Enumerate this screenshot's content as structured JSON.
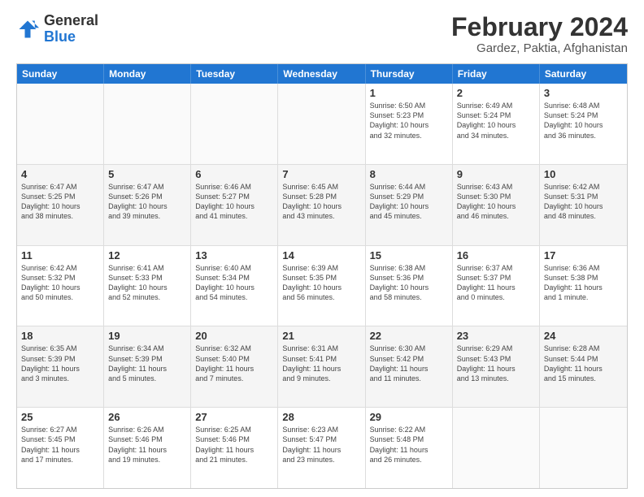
{
  "header": {
    "logo": {
      "general": "General",
      "blue": "Blue"
    },
    "title": "February 2024",
    "subtitle": "Gardez, Paktia, Afghanistan"
  },
  "calendar": {
    "days_of_week": [
      "Sunday",
      "Monday",
      "Tuesday",
      "Wednesday",
      "Thursday",
      "Friday",
      "Saturday"
    ],
    "weeks": [
      [
        {
          "day": "",
          "info": ""
        },
        {
          "day": "",
          "info": ""
        },
        {
          "day": "",
          "info": ""
        },
        {
          "day": "",
          "info": ""
        },
        {
          "day": "1",
          "info": "Sunrise: 6:50 AM\nSunset: 5:23 PM\nDaylight: 10 hours\nand 32 minutes."
        },
        {
          "day": "2",
          "info": "Sunrise: 6:49 AM\nSunset: 5:24 PM\nDaylight: 10 hours\nand 34 minutes."
        },
        {
          "day": "3",
          "info": "Sunrise: 6:48 AM\nSunset: 5:24 PM\nDaylight: 10 hours\nand 36 minutes."
        }
      ],
      [
        {
          "day": "4",
          "info": "Sunrise: 6:47 AM\nSunset: 5:25 PM\nDaylight: 10 hours\nand 38 minutes."
        },
        {
          "day": "5",
          "info": "Sunrise: 6:47 AM\nSunset: 5:26 PM\nDaylight: 10 hours\nand 39 minutes."
        },
        {
          "day": "6",
          "info": "Sunrise: 6:46 AM\nSunset: 5:27 PM\nDaylight: 10 hours\nand 41 minutes."
        },
        {
          "day": "7",
          "info": "Sunrise: 6:45 AM\nSunset: 5:28 PM\nDaylight: 10 hours\nand 43 minutes."
        },
        {
          "day": "8",
          "info": "Sunrise: 6:44 AM\nSunset: 5:29 PM\nDaylight: 10 hours\nand 45 minutes."
        },
        {
          "day": "9",
          "info": "Sunrise: 6:43 AM\nSunset: 5:30 PM\nDaylight: 10 hours\nand 46 minutes."
        },
        {
          "day": "10",
          "info": "Sunrise: 6:42 AM\nSunset: 5:31 PM\nDaylight: 10 hours\nand 48 minutes."
        }
      ],
      [
        {
          "day": "11",
          "info": "Sunrise: 6:42 AM\nSunset: 5:32 PM\nDaylight: 10 hours\nand 50 minutes."
        },
        {
          "day": "12",
          "info": "Sunrise: 6:41 AM\nSunset: 5:33 PM\nDaylight: 10 hours\nand 52 minutes."
        },
        {
          "day": "13",
          "info": "Sunrise: 6:40 AM\nSunset: 5:34 PM\nDaylight: 10 hours\nand 54 minutes."
        },
        {
          "day": "14",
          "info": "Sunrise: 6:39 AM\nSunset: 5:35 PM\nDaylight: 10 hours\nand 56 minutes."
        },
        {
          "day": "15",
          "info": "Sunrise: 6:38 AM\nSunset: 5:36 PM\nDaylight: 10 hours\nand 58 minutes."
        },
        {
          "day": "16",
          "info": "Sunrise: 6:37 AM\nSunset: 5:37 PM\nDaylight: 11 hours\nand 0 minutes."
        },
        {
          "day": "17",
          "info": "Sunrise: 6:36 AM\nSunset: 5:38 PM\nDaylight: 11 hours\nand 1 minute."
        }
      ],
      [
        {
          "day": "18",
          "info": "Sunrise: 6:35 AM\nSunset: 5:39 PM\nDaylight: 11 hours\nand 3 minutes."
        },
        {
          "day": "19",
          "info": "Sunrise: 6:34 AM\nSunset: 5:39 PM\nDaylight: 11 hours\nand 5 minutes."
        },
        {
          "day": "20",
          "info": "Sunrise: 6:32 AM\nSunset: 5:40 PM\nDaylight: 11 hours\nand 7 minutes."
        },
        {
          "day": "21",
          "info": "Sunrise: 6:31 AM\nSunset: 5:41 PM\nDaylight: 11 hours\nand 9 minutes."
        },
        {
          "day": "22",
          "info": "Sunrise: 6:30 AM\nSunset: 5:42 PM\nDaylight: 11 hours\nand 11 minutes."
        },
        {
          "day": "23",
          "info": "Sunrise: 6:29 AM\nSunset: 5:43 PM\nDaylight: 11 hours\nand 13 minutes."
        },
        {
          "day": "24",
          "info": "Sunrise: 6:28 AM\nSunset: 5:44 PM\nDaylight: 11 hours\nand 15 minutes."
        }
      ],
      [
        {
          "day": "25",
          "info": "Sunrise: 6:27 AM\nSunset: 5:45 PM\nDaylight: 11 hours\nand 17 minutes."
        },
        {
          "day": "26",
          "info": "Sunrise: 6:26 AM\nSunset: 5:46 PM\nDaylight: 11 hours\nand 19 minutes."
        },
        {
          "day": "27",
          "info": "Sunrise: 6:25 AM\nSunset: 5:46 PM\nDaylight: 11 hours\nand 21 minutes."
        },
        {
          "day": "28",
          "info": "Sunrise: 6:23 AM\nSunset: 5:47 PM\nDaylight: 11 hours\nand 23 minutes."
        },
        {
          "day": "29",
          "info": "Sunrise: 6:22 AM\nSunset: 5:48 PM\nDaylight: 11 hours\nand 26 minutes."
        },
        {
          "day": "",
          "info": ""
        },
        {
          "day": "",
          "info": ""
        }
      ]
    ]
  }
}
